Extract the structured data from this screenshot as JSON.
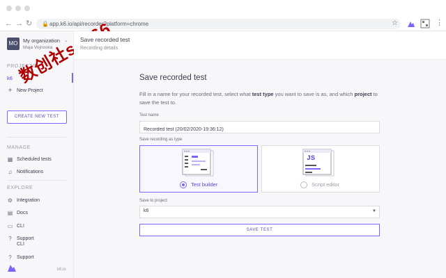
{
  "browser": {
    "url": "app.k6.io/api/recorder?platform=chrome",
    "nav": {
      "back": "←",
      "forward": "→",
      "reload": "↻"
    }
  },
  "sidebar": {
    "org_initials": "MO",
    "org_name": "My organization",
    "org_user": "Maja Vojnoska",
    "projects_label": "PROJECTS",
    "project_k6": "k6",
    "new_project": "New Project",
    "create_button": "CREATE NEW TEST",
    "manage_label": "MANAGE",
    "manage_items": [
      {
        "label": "Scheduled tests",
        "icon": "calendar-icon"
      },
      {
        "label": "Notifications",
        "icon": "bell-icon"
      }
    ],
    "explore_label": "EXPLORE",
    "explore_items": [
      {
        "label": "Integration",
        "icon": "integration-icon"
      },
      {
        "label": "Docs",
        "icon": "docs-icon"
      },
      {
        "label": "CLI",
        "icon": "cli-icon"
      },
      {
        "label": "Support",
        "label2": "CLI",
        "icon": "support-icon"
      },
      {
        "label": "Support",
        "icon": "support-icon"
      }
    ],
    "footer": "k6.io"
  },
  "watermark": "数创社scs66",
  "header": {
    "title": "Save recorded test",
    "subtitle": "Recording details"
  },
  "form": {
    "title": "Save recorded test",
    "desc_part1": "Fill in a name for your recorded test, select what ",
    "desc_bold1": "test type",
    "desc_part2": " you want to save is as, and which ",
    "desc_bold2": "project",
    "desc_part3": " to save the test to.",
    "test_name_label": "Test name",
    "test_name_value": "Recorded test (20/02/2020-19:36:12)",
    "save_as_label": "Save recording as type",
    "types": [
      {
        "label": "Test builder",
        "selected": true
      },
      {
        "label": "Script editor",
        "selected": false
      }
    ],
    "js_badge": "JS",
    "project_label": "Save to project",
    "project_value": "k6",
    "save_button": "SAVE TEST"
  },
  "colors": {
    "accent": "#7d64ff",
    "sidebar_bg": "#f7f7fa"
  }
}
